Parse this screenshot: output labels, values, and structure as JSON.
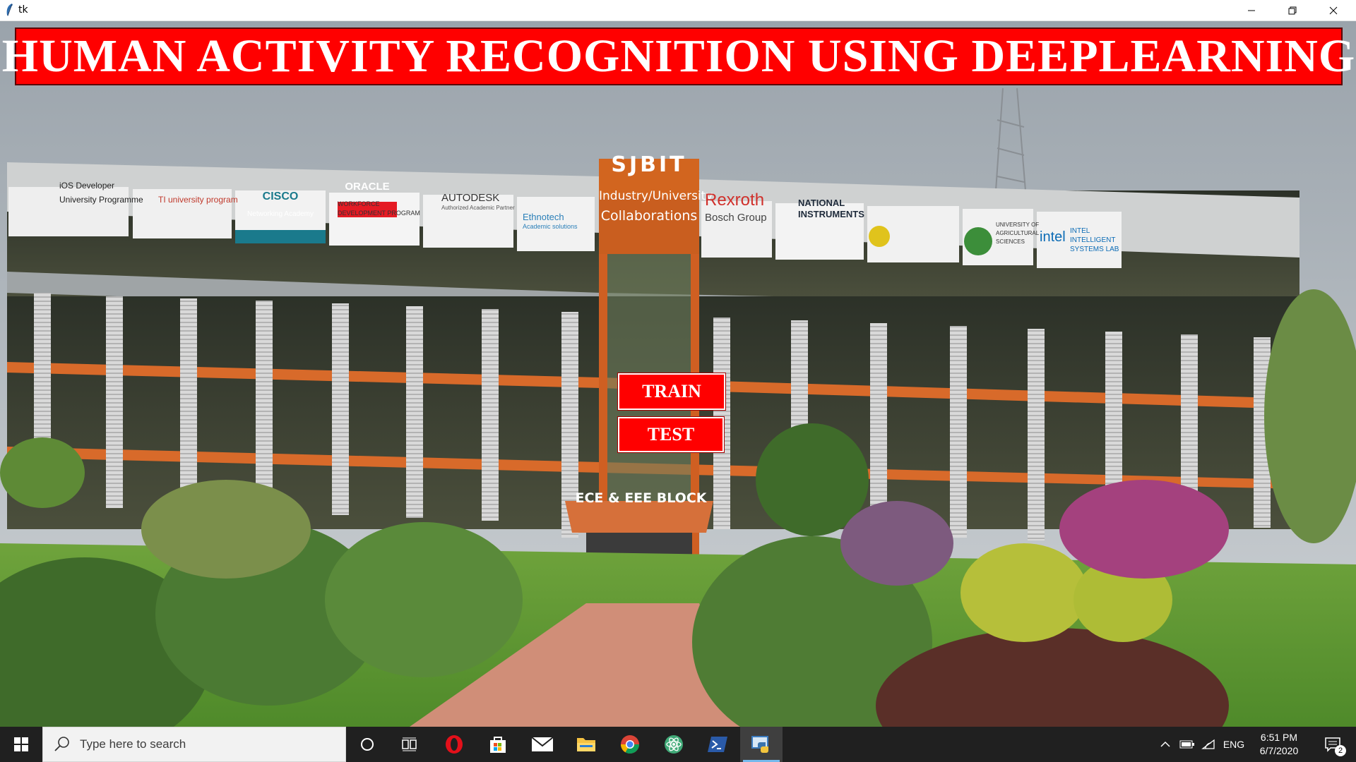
{
  "window": {
    "title": "tk",
    "app_icon": "feather-icon",
    "controls": {
      "minimize": "minimize-icon",
      "maximize": "restore-icon",
      "close": "close-icon"
    }
  },
  "banner": {
    "title": "HUMAN ACTIVITY RECOGNITION USING DEEPLEARNING"
  },
  "buttons": {
    "train_label": "TRAIN",
    "test_label": "TEST"
  },
  "background": {
    "sign_main": "SJBIT",
    "sign_collab_line1": "Industry/University",
    "sign_collab_line2": "Collaborations",
    "block_sign": "ECE & EEE BLOCK",
    "logos": {
      "ios_line1": "iOS Developer",
      "ios_line2": "University Programme",
      "ti": "TI university program",
      "cisco": "CISCO",
      "cisco_sub": "Networking Academy",
      "oracle": "ORACLE",
      "oracle_sub1": "WORKFORCE",
      "oracle_sub2": "DEVELOPMENT PROGRAM",
      "autodesk": "AUTODESK",
      "autodesk_sub": "Authorized Academic Partner",
      "ethnotech": "Ethnotech",
      "ethnotech_sub": "Academic solutions",
      "rexroth": "Rexroth",
      "bosch": "Bosch Group",
      "ni_line1": "NATIONAL",
      "ni_line2": "INSTRUMENTS",
      "uas_line1": "UNIVERSITY OF",
      "uas_line2": "AGRICULTURAL",
      "uas_line3": "SCIENCES",
      "intel": "intel",
      "intel_line1": "INTEL",
      "intel_line2": "INTELLIGENT",
      "intel_line3": "SYSTEMS LAB"
    }
  },
  "taskbar": {
    "search_placeholder": "Type here to search",
    "pinned": [
      "cortana-circle-icon",
      "task-view-icon",
      "opera-icon",
      "store-icon",
      "mail-icon",
      "file-explorer-icon",
      "chrome-icon",
      "atom-icon",
      "powershell-icon",
      "python-icon"
    ],
    "language": "ENG",
    "time": "6:51 PM",
    "date": "6/7/2020",
    "notification_count": "2"
  },
  "colors": {
    "banner_red": "#ff0000",
    "button_red": "#ff0000",
    "taskbar": "#202020"
  }
}
